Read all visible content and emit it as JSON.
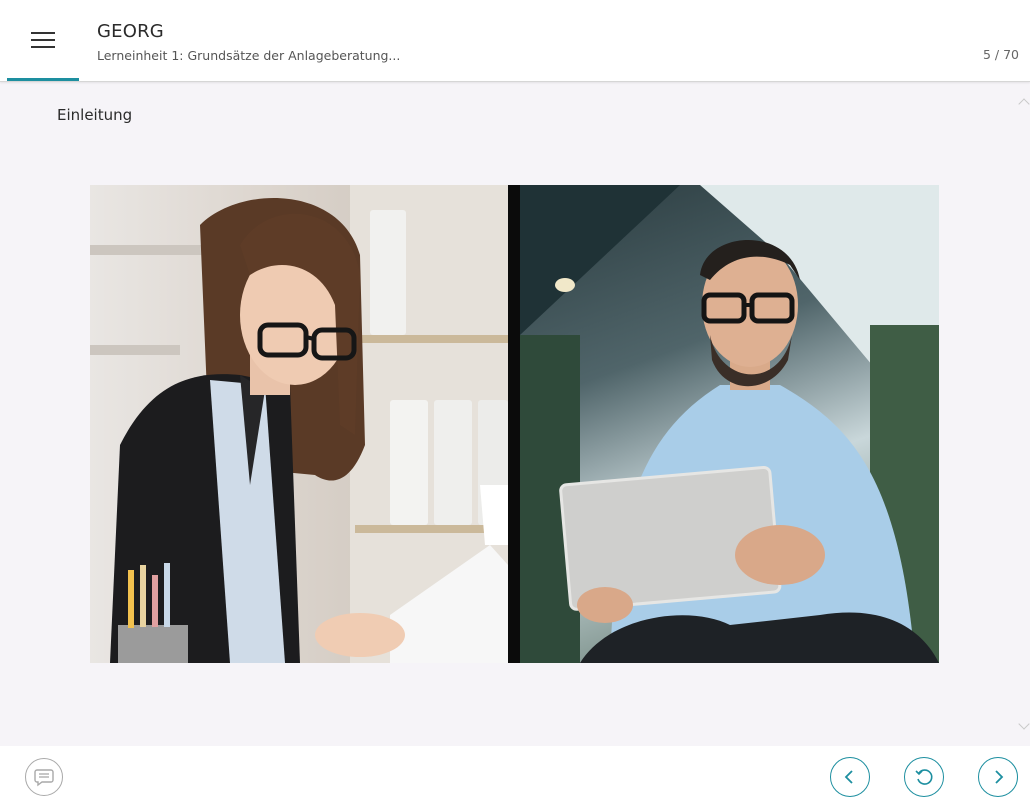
{
  "header": {
    "app_title": "GEORG",
    "lesson_title": "Lerneinheit 1: Grundsätze der Anlageberatung...",
    "page_counter": "5 / 70"
  },
  "content": {
    "section_title": "Einleitung"
  },
  "icons": {
    "menu": "hamburger-menu-icon",
    "comment": "comment-icon",
    "prev": "chevron-left-icon",
    "reload": "reload-icon",
    "next": "chevron-right-icon"
  },
  "colors": {
    "accent": "#1d8fa0",
    "content_background": "#f6f4f8",
    "muted_icon": "#a9a9a9"
  }
}
